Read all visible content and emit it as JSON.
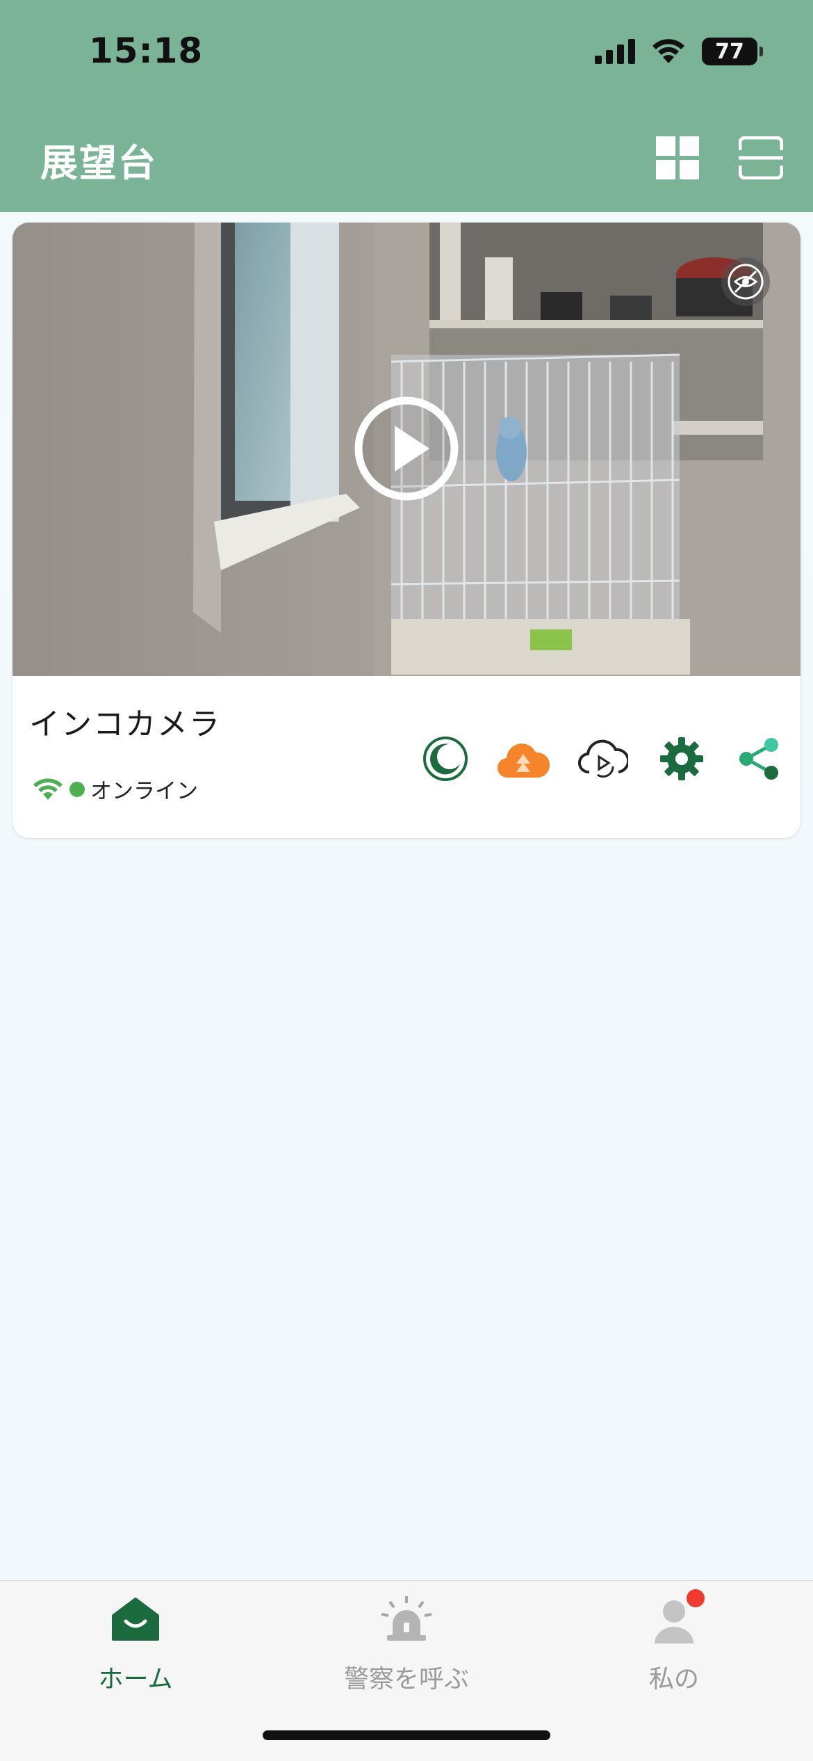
{
  "status_bar": {
    "time": "15:18",
    "battery": "77"
  },
  "header": {
    "title": "展望台",
    "grid_icon": "grid-view-icon",
    "scan_icon": "scan-icon"
  },
  "camera_card": {
    "name": "インコカメラ",
    "status": "オンライン",
    "status_color": "#4cb050",
    "actions": [
      {
        "icon": "moon-icon",
        "color": "#1b6b3f"
      },
      {
        "icon": "cloud-upload-icon",
        "color": "#f5842b"
      },
      {
        "icon": "cloud-playback-icon",
        "color": "#222222"
      },
      {
        "icon": "gear-icon",
        "color": "#1b6b3f"
      },
      {
        "icon": "share-icon",
        "color": "#2aa873"
      }
    ]
  },
  "tabs": [
    {
      "label": "ホーム",
      "icon": "home-icon",
      "active": true
    },
    {
      "label": "警察を呼ぶ",
      "icon": "siren-icon",
      "active": false
    },
    {
      "label": "私の",
      "icon": "person-icon",
      "active": false,
      "badge": true
    }
  ],
  "colors": {
    "header_bg": "#7bb396",
    "accent": "#1b6b3f",
    "inactive_tab": "#9a9a9a",
    "badge": "#f0392f"
  }
}
